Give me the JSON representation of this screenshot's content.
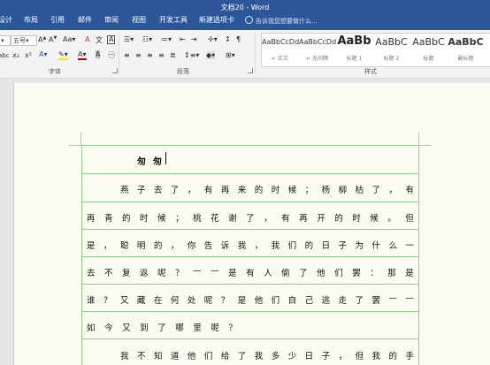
{
  "window": {
    "title": "文档20 - Word"
  },
  "tabs": [
    "设计",
    "布局",
    "引用",
    "邮件",
    "审阅",
    "视图",
    "开发工具",
    "新建选项卡"
  ],
  "tell_me": {
    "placeholder": "告诉我您想要做什么..."
  },
  "ribbon": {
    "font_size": "五号",
    "groups": {
      "font": "字体",
      "paragraph": "段落",
      "styles": "样式"
    },
    "styles": [
      {
        "preview": "AaBbCcDd",
        "name": "↵ 正文"
      },
      {
        "preview": "AaBbCcDd",
        "name": "↵ 无间隔"
      },
      {
        "preview": "AaBb",
        "name": "标题 1"
      },
      {
        "preview": "AaBbC",
        "name": "标题 2"
      },
      {
        "preview": "AaBbC",
        "name": "标题"
      },
      {
        "preview": "AaBbC",
        "name": "副标题"
      }
    ]
  },
  "document": {
    "title": "匆匆",
    "lines": [
      "燕子去了，有再来的时候；杨柳枯了，有",
      "再青的时候；桃花谢了，有再开的时候。但",
      "是，聪明的，你告诉我，我们的日子为什么一",
      "去不复返呢？——是有人偷了他们罢：那是",
      "谁？又藏在何处呢？是他们自己逃走了罢——",
      "如今又到了哪里呢？",
      "我不知道他们给了我多少日子，但我的手"
    ]
  },
  "colors": {
    "accent": "#2b579a",
    "grid": "#8fd08f",
    "page": "#fbfbf2"
  }
}
